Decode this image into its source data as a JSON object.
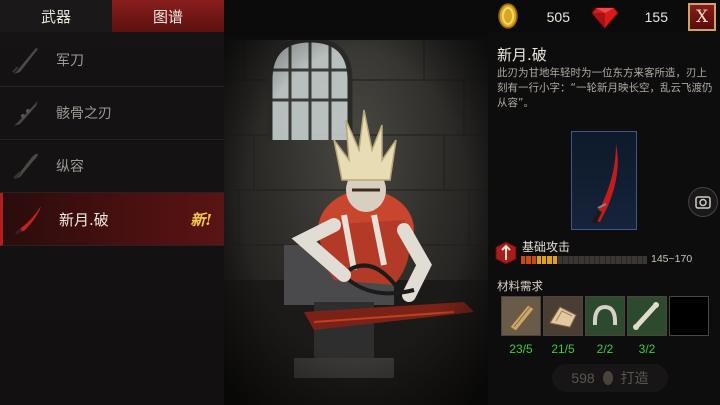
{
  "tabs": [
    {
      "label": "武器",
      "active": false
    },
    {
      "label": "图谱",
      "active": true
    }
  ],
  "weapons": [
    {
      "name": "军刀",
      "icon": "saber-icon"
    },
    {
      "name": "骸骨之刃",
      "icon": "bone-blade-icon"
    },
    {
      "name": "纵容",
      "icon": "indulgence-blade-icon"
    },
    {
      "name": "新月.破",
      "icon": "crescent-blade-icon",
      "selected": true,
      "badge": "新!"
    }
  ],
  "currency": {
    "coins": "505",
    "gems": "155"
  },
  "close_label": "X",
  "detail": {
    "title": "新月.破",
    "description": "此刃为甘地年轻时为一位东方来客所造，刃上刻有一行小字：“一轮新月映长空，乱云飞渡仍从容”。",
    "stat_label": "基础攻击",
    "stat_range": "145~170",
    "stat_fill": 0.3,
    "materials_label": "材料需求",
    "materials": [
      {
        "icon": "wood-plank-icon",
        "count": "23/5"
      },
      {
        "icon": "leather-pile-icon",
        "count": "21/5"
      },
      {
        "icon": "horseshoe-crest-icon",
        "count": "2/2"
      },
      {
        "icon": "bone-shard-icon",
        "count": "3/2"
      },
      {
        "icon": "empty-slot",
        "count": ""
      }
    ],
    "craft_cost": "598",
    "craft_label": "打造"
  },
  "colors": {
    "accent_red": "#8a1e1e",
    "new_badge": "#f2c84a",
    "material_count": "#3ecb3e"
  }
}
